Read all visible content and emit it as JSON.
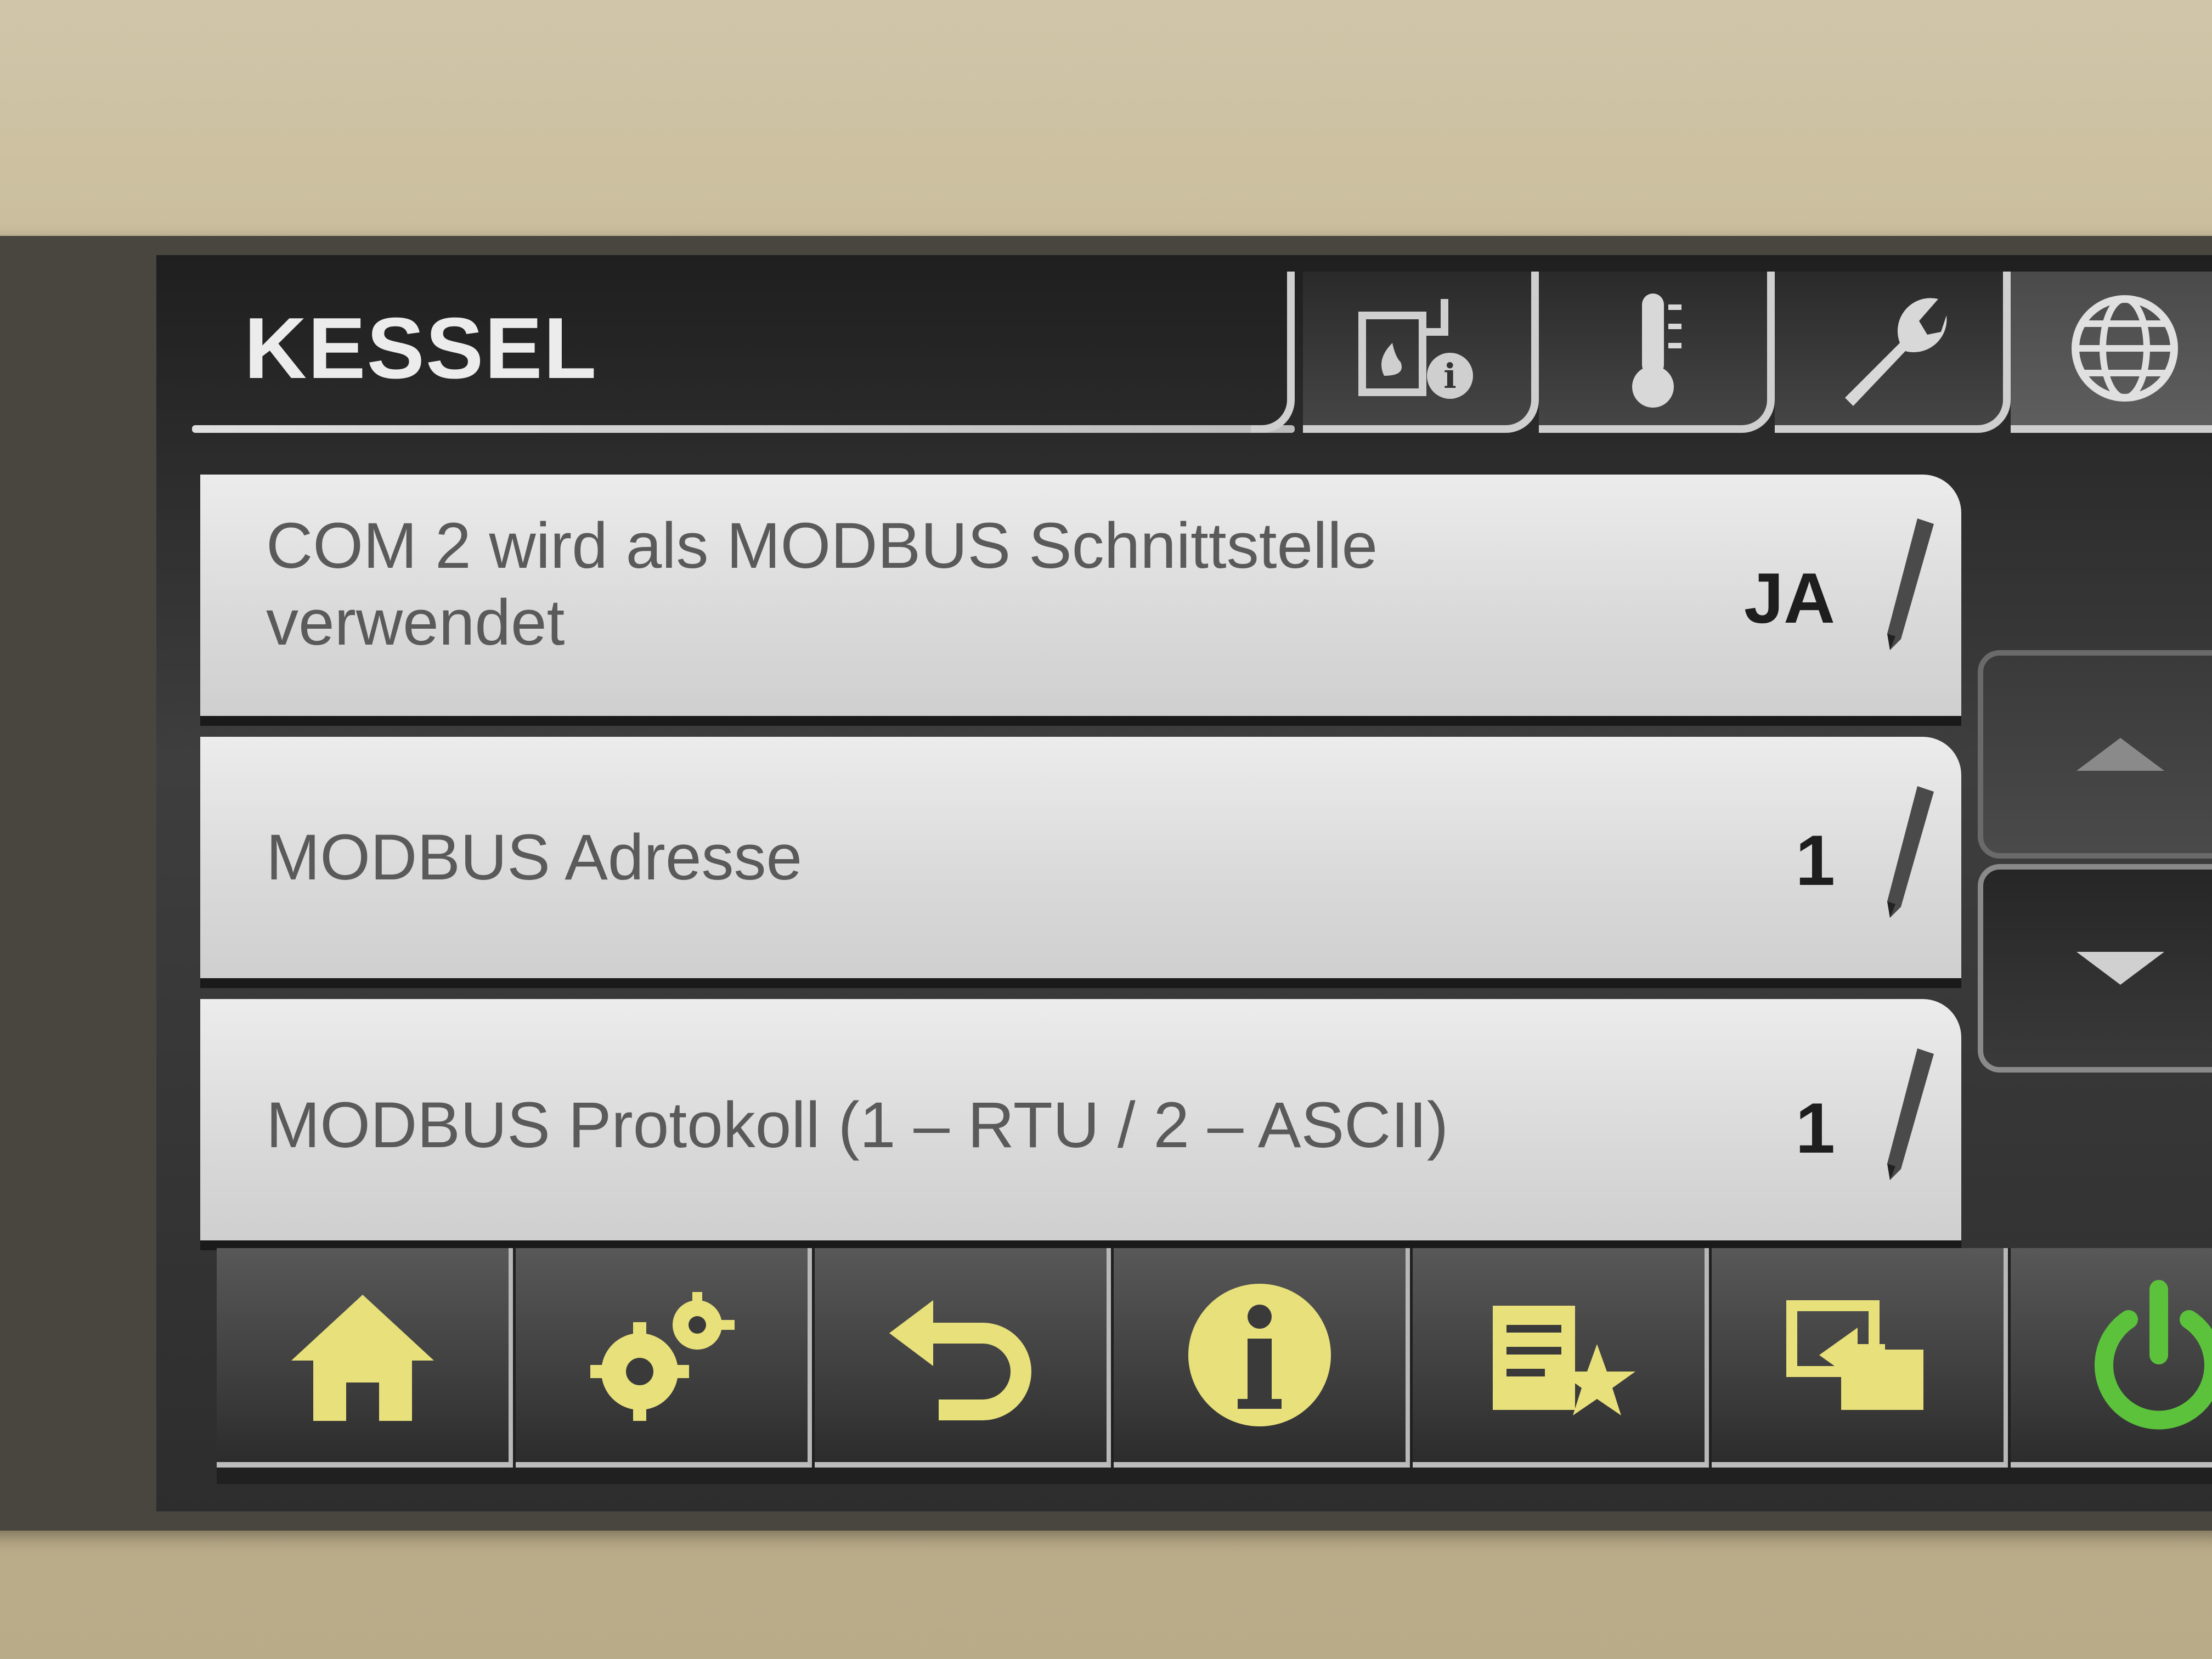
{
  "header": {
    "title": "KESSEL",
    "tabs": [
      {
        "icon": "boiler-info-icon"
      },
      {
        "icon": "thermometer-icon"
      },
      {
        "icon": "wrench-icon"
      },
      {
        "icon": "globe-icon"
      }
    ]
  },
  "settings": [
    {
      "label": "COM 2 wird als MODBUS Schnittstelle verwendet",
      "value": "JA",
      "icon": "pencil-icon"
    },
    {
      "label": "MODBUS Adresse",
      "value": "1",
      "icon": "pencil-icon"
    },
    {
      "label": "MODBUS Protokoll (1 – RTU / 2 – ASCII)",
      "value": "1",
      "icon": "pencil-icon"
    }
  ],
  "scroll": {
    "up_icon": "arrow-up-icon",
    "down_icon": "arrow-down-icon"
  },
  "toolbar": [
    {
      "icon": "home-icon"
    },
    {
      "icon": "gears-icon"
    },
    {
      "icon": "back-icon"
    },
    {
      "icon": "info-icon"
    },
    {
      "icon": "favorites-icon"
    },
    {
      "icon": "screen-switch-icon"
    },
    {
      "icon": "power-icon"
    }
  ],
  "colors": {
    "toolbar_icon": "#e8e07a",
    "power": "#5cc23c",
    "row_bg": "#e2e2e2",
    "screen_bg": "#2e2e2e"
  }
}
